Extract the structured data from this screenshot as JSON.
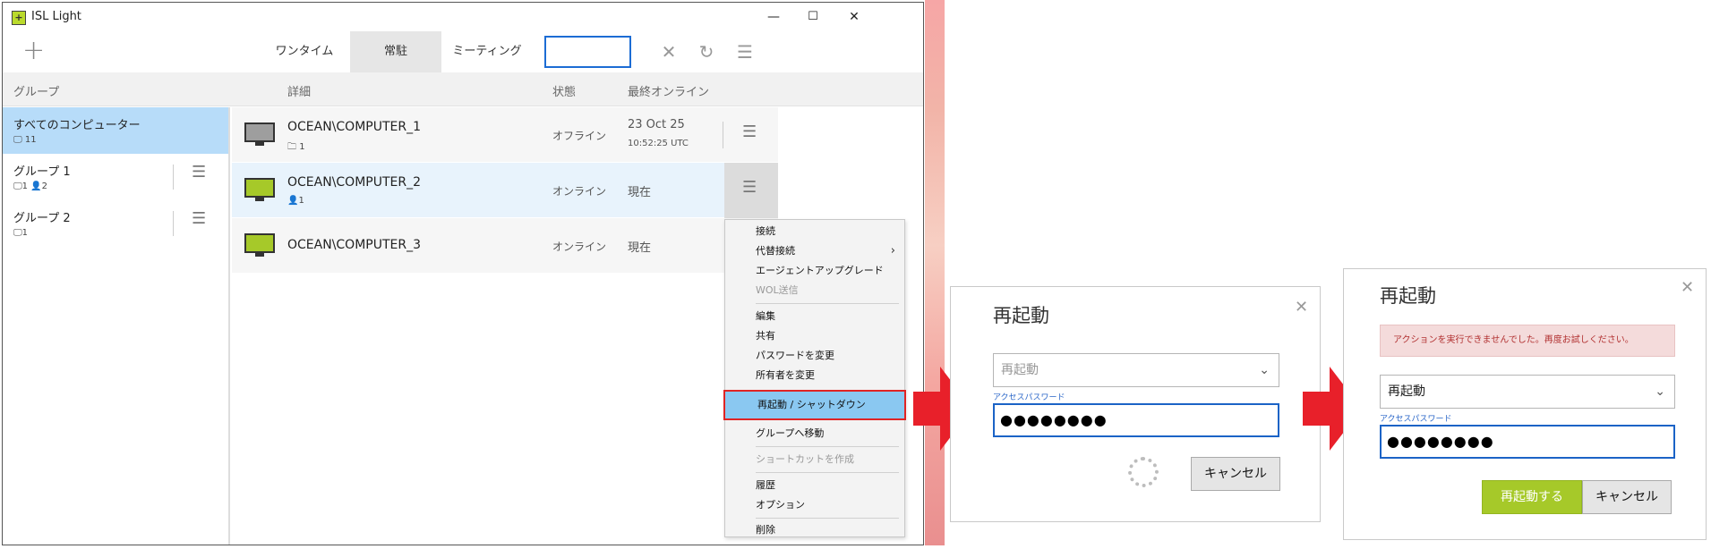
{
  "window": {
    "title": "ISL Light",
    "app_icon": "isl-light-icon",
    "controls": {
      "minimize": "—",
      "maximize": "☐",
      "close": "✕"
    }
  },
  "toolbar": {
    "add": "+",
    "tabs": [
      {
        "label": "ワンタイム",
        "active": false
      },
      {
        "label": "常駐",
        "active": true
      },
      {
        "label": "ミーティング",
        "active": false
      }
    ],
    "search_value": "",
    "icons": {
      "clear": "✕",
      "refresh": "↻",
      "menu": "☰"
    }
  },
  "columns": {
    "group": "グループ",
    "details": "詳細",
    "status": "状態",
    "last_online": "最終オンライン"
  },
  "groups": [
    {
      "name": "すべてのコンピューター",
      "computers": "11",
      "selected": true
    },
    {
      "name": "グループ 1",
      "computers": "1",
      "users": "2",
      "selected": false
    },
    {
      "name": "グループ 2",
      "computers": "1",
      "selected": false
    }
  ],
  "computers": [
    {
      "name": "OCEAN\\COMPUTER_1",
      "sub": "1",
      "sub_icon": "folder-icon",
      "status": "オフライン",
      "last": "23 Oct 25",
      "last_time": "10:52:25 UTC",
      "online": false
    },
    {
      "name": "OCEAN\\COMPUTER_2",
      "sub": "1",
      "sub_icon": "user-icon",
      "status": "オンライン",
      "last": "現在",
      "online": true
    },
    {
      "name": "OCEAN\\COMPUTER_3",
      "status": "オンライン",
      "last": "現在",
      "online": true
    }
  ],
  "context_menu": {
    "items": [
      {
        "label": "接続"
      },
      {
        "label": "代替接続",
        "submenu": "›"
      },
      {
        "label": "エージェントアップグレード"
      },
      {
        "label": "WOL送信",
        "disabled": true
      },
      {
        "label": "編集"
      },
      {
        "label": "共有"
      },
      {
        "label": "パスワードを変更"
      },
      {
        "label": "所有者を変更"
      },
      {
        "label": "再起動 / シャットダウン",
        "highlighted": true
      },
      {
        "label": "グループへ移動"
      },
      {
        "label": "ショートカットを作成",
        "disabled": true
      },
      {
        "label": "履歴"
      },
      {
        "label": "オプション"
      },
      {
        "label": "削除"
      }
    ]
  },
  "dialog1": {
    "title": "再起動",
    "action_placeholder": "再起動",
    "password_label": "アクセスパスワード",
    "password_value": "●●●●●●●●",
    "cancel": "キャンセル"
  },
  "dialog2": {
    "title": "再起動",
    "error": "アクションを実行できませんでした。再度お試しください。",
    "action_value": "再起動",
    "password_label": "アクセスパスワード",
    "password_value": "●●●●●●●●",
    "confirm": "再起動する",
    "cancel": "キャンセル"
  },
  "colors": {
    "accent": "#1c6cd4",
    "selection": "#b7dcf9",
    "online_monitor": "#a6c929",
    "offline_monitor": "#9e9e9e",
    "highlight_border": "#e02424",
    "arrow": "#e8202a",
    "error_bg": "#f4dbdb"
  }
}
